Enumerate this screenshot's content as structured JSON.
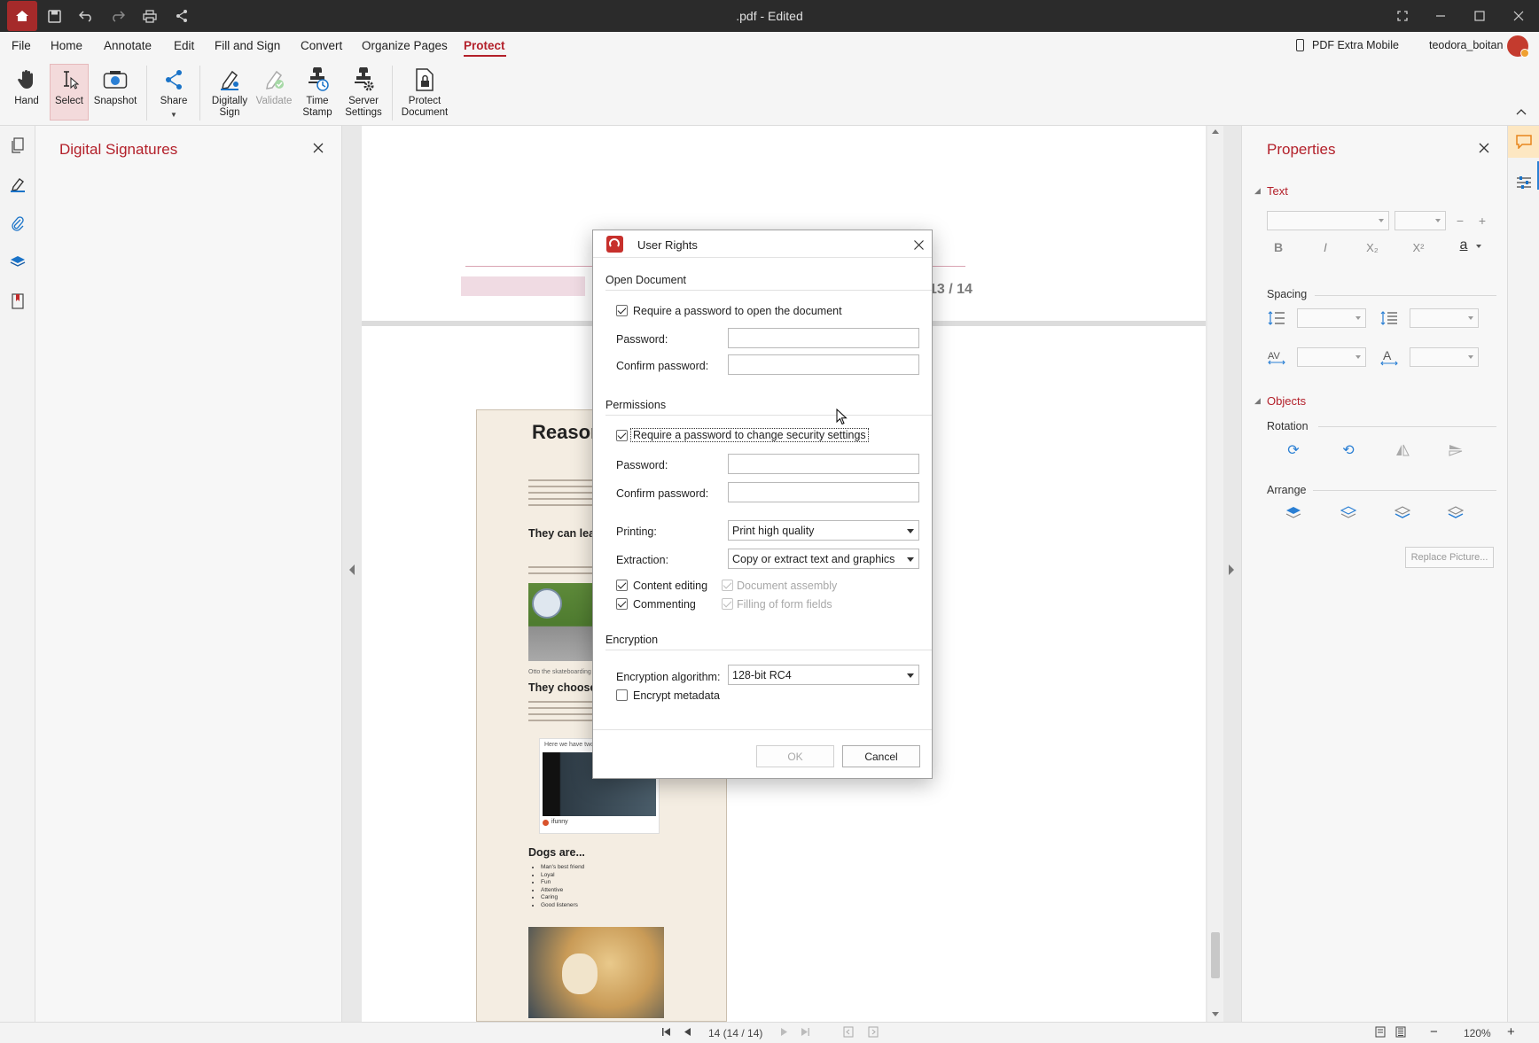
{
  "window": {
    "title": ".pdf - Edited"
  },
  "menu": {
    "file": "File",
    "home": "Home",
    "annotate": "Annotate",
    "edit": "Edit",
    "fill_sign": "Fill and Sign",
    "convert": "Convert",
    "organize": "Organize Pages",
    "protect": "Protect",
    "mobile": "PDF Extra Mobile",
    "user": "teodora_boitan"
  },
  "ribbon": {
    "hand": "Hand",
    "select": "Select",
    "snapshot": "Snapshot",
    "share": "Share",
    "digitally_1": "Digitally",
    "digitally_2": "Sign",
    "validate": "Validate",
    "timestamp_1": "Time",
    "timestamp_2": "Stamp",
    "server_1": "Server",
    "server_2": "Settings",
    "protect_1": "Protect",
    "protect_2": "Document"
  },
  "left_panel": {
    "title": "Digital Signatures"
  },
  "document": {
    "page_counter": "13 / 14",
    "heading": "Reasons w… the",
    "h_skate": "They can lea… skateboard",
    "caption_otto": "Otto the skateboarding",
    "h_choose": "They choose",
    "caption_here": "Here we have two ty",
    "ifunny": "ifunny",
    "h_dogs": "Dogs are...",
    "dogs_list": [
      "Man's best friend",
      "Loyal",
      "Fun",
      "Attentive",
      "Caring",
      "Good listeners"
    ]
  },
  "dialog": {
    "title": "User Rights",
    "open_doc": "Open Document",
    "req_open": "Require a password to open the document",
    "password": "Password:",
    "confirm": "Confirm password:",
    "permissions": "Permissions",
    "req_change": "Require a password to change security settings",
    "printing_label": "Printing:",
    "printing_value": "Print high quality",
    "extraction_label": "Extraction:",
    "extraction_value": "Copy or extract text and graphics",
    "content_editing": "Content editing",
    "doc_assembly": "Document assembly",
    "commenting": "Commenting",
    "filling_forms": "Filling of form fields",
    "encryption": "Encryption",
    "algo_label": "Encryption algorithm:",
    "algo_value": "128-bit RC4",
    "encrypt_meta": "Encrypt metadata",
    "ok": "OK",
    "cancel": "Cancel",
    "req_open_checked": true,
    "req_change_checked": true,
    "content_editing_checked": true,
    "commenting_checked": true,
    "doc_assembly_checked": true,
    "filling_forms_checked": true,
    "encrypt_meta_checked": false
  },
  "right_panel": {
    "title": "Properties",
    "text": "Text",
    "spacing": "Spacing",
    "objects": "Objects",
    "rotation": "Rotation",
    "arrange": "Arrange",
    "replace": "Replace Picture..."
  },
  "status": {
    "pages": "14 (14 / 14)",
    "zoom": "120%"
  },
  "colors": {
    "accent": "#b3202a",
    "titlebar": "#2b2b2b",
    "link_blue": "#1a73c8"
  }
}
